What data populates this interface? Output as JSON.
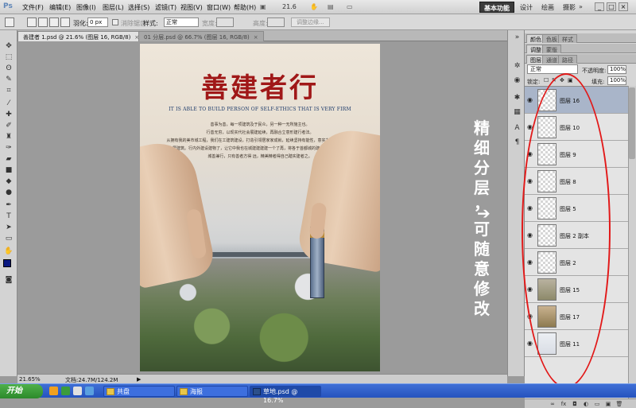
{
  "app": {
    "logo": "Ps",
    "zoom_readout": "21.6"
  },
  "menu": [
    "文件(F)",
    "编辑(E)",
    "图像(I)",
    "图层(L)",
    "选择(S)",
    "滤镜(T)",
    "视图(V)",
    "窗口(W)",
    "帮助(H)"
  ],
  "workspaces": {
    "active": "基本功能",
    "design": "设计",
    "paint": "绘画",
    "photo": "摄影"
  },
  "window_controls": [
    "_",
    "□",
    "×"
  ],
  "options": {
    "feather_label": "羽化:",
    "feather_value": "0 px",
    "antialias_label": "消除锯齿",
    "style_label": "样式:",
    "style_value": "正常",
    "width_label": "宽度:",
    "height_label": "高度:",
    "refine_edge": "调整边缘..."
  },
  "tabs": [
    {
      "label": "善建者 1.psd @ 21.6% (图层 16, RGB/8)",
      "close": "×"
    },
    {
      "label": "01 分层.psd @ 66.7% (图层 16, RGB/8)",
      "close": "×"
    }
  ],
  "poster": {
    "title": "善建者行",
    "subtitle": "IT IS ABLE TO BUILD PERSON OF SELF-ETHICS THAT IS VERY FIRM",
    "body": [
      "善事为善，每一项建筑及于民众，另一种一无所施主也。",
      "行善无穷，以现实代社会展建延续，再融合立意形建行者法。",
      "从拥有我的美市城工程，我们在工建筑建设，打造引领居家家成就，延续坚持有能性，意实力，也是城建。",
      "建一执居建筑。行内外建设建物了，让它中我也在城建建建建一个了再，将各于首都城的建平面城装。高楼城楼，",
      "城善兼行，只有善者方得     远，精美精者得自己踏实建者之。"
    ]
  },
  "annotation": {
    "text_col1": [
      "精",
      "细",
      "分",
      "层",
      "，"
    ],
    "text_col2": [
      "可",
      "随",
      "意",
      "修",
      "改"
    ],
    "arrow": "➔"
  },
  "panels": {
    "tabs_row1": [
      "颜色",
      "色板",
      "样式"
    ],
    "tabs_row2": [
      "调整",
      "蒙版"
    ],
    "tabs_row3": [
      "图层",
      "通道",
      "路径"
    ],
    "blend_mode": "正常",
    "opacity_label": "不透明度:",
    "opacity_value": "100%",
    "lock_label": "锁定:",
    "fill_label": "填充:",
    "fill_value": "100%"
  },
  "layers": [
    {
      "name": "图层 16",
      "selected": true
    },
    {
      "name": "图层 10",
      "selected": false
    },
    {
      "name": "图层 9",
      "selected": false
    },
    {
      "name": "图层 8",
      "selected": false
    },
    {
      "name": "图层 5",
      "selected": false
    },
    {
      "name": "图层 2 副本",
      "selected": false
    },
    {
      "name": "图层 2",
      "selected": false
    },
    {
      "name": "图层 15",
      "selected": false
    },
    {
      "name": "图层 17",
      "selected": false
    },
    {
      "name": "图层 11",
      "selected": false
    }
  ],
  "status": {
    "zoom": "21.65%",
    "doc": "文档:24.7M/124.2M"
  },
  "taskbar": {
    "start": "开始",
    "items": [
      {
        "label": "共盘",
        "active": false
      },
      {
        "label": "海报",
        "active": false
      },
      {
        "label": "草地.psd @ 16.7%",
        "active": true
      }
    ]
  },
  "colors": {
    "foreground": "#0a1880",
    "background": "#ffffff",
    "annotation_ellipse": "#e21919",
    "title_red": "#a01818"
  }
}
